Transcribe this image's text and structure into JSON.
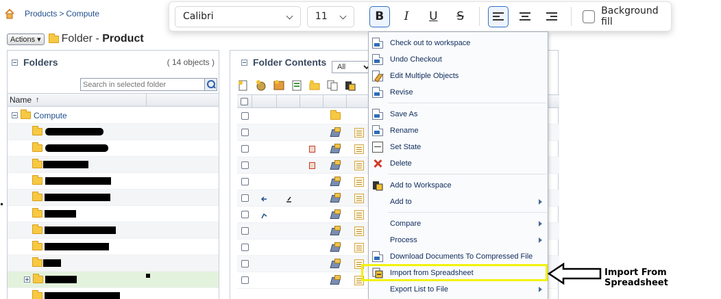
{
  "breadcrumb": {
    "root": "Products",
    "separator": ">",
    "current": "Compute"
  },
  "title_row": {
    "actions_label": "Actions",
    "title_prefix": "Folder - ",
    "title_name": "Product"
  },
  "left_panel": {
    "title": "Folders",
    "count": "( 14 objects )",
    "search_placeholder": "Search in selected folder",
    "column_name": "Name",
    "sort_arrow": "↑",
    "root_item": "Compute"
  },
  "right_panel": {
    "title": "Folder Contents",
    "filter_value": "All"
  },
  "format_toolbar": {
    "font_family": "Calibri",
    "font_size": "11",
    "bold": "B",
    "italic": "I",
    "underline": "U",
    "strike": "S",
    "background_fill_label": "Background fill"
  },
  "context_menu": {
    "items": [
      {
        "label": "Check out to workspace",
        "icon": "checkout-icon"
      },
      {
        "label": "Undo Checkout",
        "icon": "undo-checkout-icon"
      },
      {
        "label": "Edit Multiple Objects",
        "icon": "edit-icon"
      },
      {
        "label": "Revise",
        "icon": "revise-icon"
      },
      {
        "label": "Save As",
        "icon": "save-as-icon"
      },
      {
        "label": "Rename",
        "icon": "rename-icon"
      },
      {
        "label": "Set State",
        "icon": "set-state-icon"
      },
      {
        "label": "Delete",
        "icon": "delete-icon"
      },
      {
        "label": "Add to Workspace",
        "icon": "add-workspace-icon"
      },
      {
        "label": "Add to",
        "icon": ""
      },
      {
        "label": "Compare",
        "icon": ""
      },
      {
        "label": "Process",
        "icon": ""
      },
      {
        "label": "Download Documents To Compressed File",
        "icon": "download-icon"
      },
      {
        "label": "Import from Spreadsheet",
        "icon": "import-spreadsheet-icon"
      },
      {
        "label": "Export List to File",
        "icon": ""
      }
    ]
  },
  "annotation": {
    "text": "Import From Spreadsheet",
    "highlight_color": "#f2f200"
  },
  "colors": {
    "link": "#1f4e8c",
    "menu_text": "#0d2a5c",
    "selected_row": "#e3f2dc"
  }
}
